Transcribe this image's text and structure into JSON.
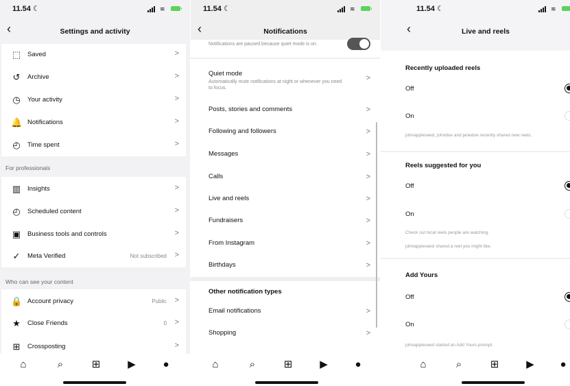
{
  "status": {
    "time": "11.54",
    "moon": "☾"
  },
  "panel1": {
    "title": "Settings and activity",
    "rows_top": [
      {
        "label": "Saved",
        "icon": "⬚"
      },
      {
        "label": "Archive",
        "icon": "↺"
      },
      {
        "label": "Your activity",
        "icon": "◷"
      },
      {
        "label": "Notifications",
        "icon": "🔔"
      },
      {
        "label": "Time spent",
        "icon": "◴"
      }
    ],
    "section_pro": "For professionals",
    "rows_pro": [
      {
        "label": "Insights",
        "icon": "▥"
      },
      {
        "label": "Scheduled content",
        "icon": "◴"
      },
      {
        "label": "Business tools and controls",
        "icon": "▣"
      },
      {
        "label": "Meta Verified",
        "icon": "✓",
        "value": "Not subscribed"
      }
    ],
    "section_who": "Who can see your content",
    "rows_who": [
      {
        "label": "Account privacy",
        "icon": "🔒",
        "value": "Public"
      },
      {
        "label": "Close Friends",
        "icon": "★",
        "value": "0"
      },
      {
        "label": "Crossposting",
        "icon": "⊞"
      }
    ]
  },
  "panel2": {
    "title": "Notifications",
    "paused_note": "Notifications are paused because quiet mode is on.",
    "quiet_label": "Quiet mode",
    "quiet_sub": "Automatically mute notifications at night or whenever you need to focus.",
    "rows": [
      "Posts, stories and comments",
      "Following and followers",
      "Messages",
      "Calls",
      "Live and reels",
      "Fundraisers",
      "From Instagram",
      "Birthdays"
    ],
    "other_header": "Other notification types",
    "other_rows": [
      "Email notifications",
      "Shopping"
    ]
  },
  "panel3": {
    "title": "Live and reels",
    "groups": [
      {
        "header": "Recently uploaded reels",
        "off": "Off",
        "on": "On",
        "selected": "off",
        "note": "johnappleseed, johndoe and janedoe recently shared new reels."
      },
      {
        "header": "Reels suggested for you",
        "off": "Off",
        "on": "On",
        "selected": "off",
        "note": "Check out local reels people are watching.",
        "note2": "johnappleseed shared a reel you might like."
      },
      {
        "header": "Add Yours",
        "off": "Off",
        "on": "On",
        "selected": "off",
        "note": "johnappleseed started an Add Yours prompt."
      }
    ]
  },
  "tabbar": {
    "home_icon": "⌂",
    "search_icon": "⌕",
    "create_icon": "⊞",
    "reels_icon": "▶",
    "profile_icon": "●"
  },
  "colors": {
    "toggle": "#555555",
    "battery": "#5bd35b"
  }
}
